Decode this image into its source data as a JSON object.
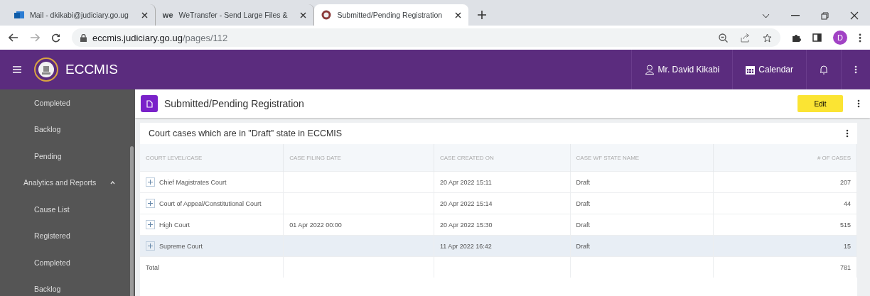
{
  "browser": {
    "tabs": [
      {
        "title": "Mail - dkikabi@judiciary.go.ug",
        "selected": false
      },
      {
        "title": "WeTransfer - Send Large Files &",
        "icon_text": "we",
        "selected": false
      },
      {
        "title": "Submitted/Pending Registration",
        "selected": true
      }
    ],
    "url_host": "eccmis.judiciary.go.ug",
    "url_path": "/pages/112",
    "profile_initial": "D"
  },
  "app": {
    "title": "ECCMIS",
    "user": "Mr. David Kikabi",
    "calendar": "Calendar"
  },
  "sidebar": {
    "items": [
      {
        "label": "Completed",
        "kind": "sub"
      },
      {
        "label": "Backlog",
        "kind": "sub"
      },
      {
        "label": "Pending",
        "kind": "sub"
      },
      {
        "label": "Analytics and Reports",
        "kind": "group",
        "expanded": true
      },
      {
        "label": "Cause List",
        "kind": "sub"
      },
      {
        "label": "Registered",
        "kind": "sub"
      },
      {
        "label": "Completed",
        "kind": "sub"
      },
      {
        "label": "Backlog",
        "kind": "sub"
      }
    ]
  },
  "page": {
    "title": "Submitted/Pending Registration",
    "edit_button": "Edit"
  },
  "card": {
    "title": "Court cases which are in \"Draft\" state in ECCMIS"
  },
  "table": {
    "columns": [
      "COURT LEVEL/CASE",
      "CASE FILING DATE",
      "CASE CREATED ON",
      "CASE WF STATE NAME",
      "# OF CASES"
    ],
    "rows": [
      {
        "cells": [
          "Chief Magistrates Court",
          "",
          "20 Apr 2022 15:11",
          "Draft",
          "207"
        ],
        "expandable": true,
        "selected": false
      },
      {
        "cells": [
          "Court of Appeal/Constitutional Court",
          "",
          "20 Apr 2022 15:14",
          "Draft",
          "44"
        ],
        "expandable": true,
        "selected": false
      },
      {
        "cells": [
          "High Court",
          "01 Apr 2022 00:00",
          "20 Apr 2022 15:30",
          "Draft",
          "515"
        ],
        "expandable": true,
        "selected": false
      },
      {
        "cells": [
          "Supreme Court",
          "",
          "11 Apr 2022 16:42",
          "Draft",
          "15"
        ],
        "expandable": true,
        "selected": true
      },
      {
        "cells": [
          "Total",
          "",
          "",
          "",
          "781"
        ],
        "expandable": false,
        "selected": false
      }
    ]
  }
}
